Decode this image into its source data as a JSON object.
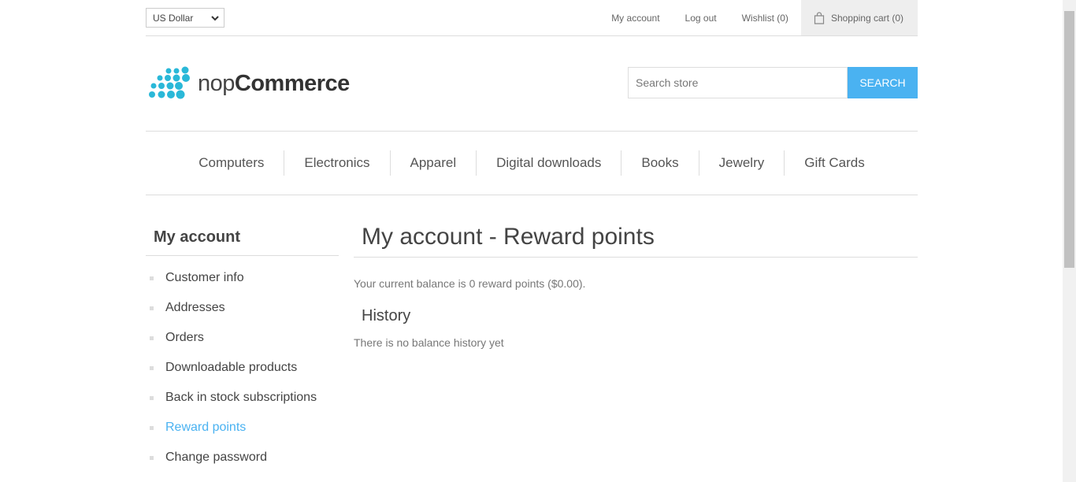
{
  "header": {
    "currency": "US Dollar",
    "links": {
      "my_account": "My account",
      "log_out": "Log out",
      "wishlist": "Wishlist (0)",
      "shopping_cart": "Shopping cart (0)"
    },
    "logo": {
      "part1": "nop",
      "part2": "Commerce"
    },
    "search": {
      "placeholder": "Search store",
      "button": "SEARCH"
    }
  },
  "menu": [
    "Computers",
    "Electronics",
    "Apparel",
    "Digital downloads",
    "Books",
    "Jewelry",
    "Gift Cards"
  ],
  "sidebar": {
    "title": "My account",
    "items": [
      {
        "label": "Customer info"
      },
      {
        "label": "Addresses"
      },
      {
        "label": "Orders"
      },
      {
        "label": "Downloadable products"
      },
      {
        "label": "Back in stock subscriptions"
      },
      {
        "label": "Reward points",
        "active": true
      },
      {
        "label": "Change password"
      }
    ]
  },
  "main": {
    "title": "My account - Reward points",
    "balance": "Your current balance is 0 reward points ($0.00).",
    "history_title": "History",
    "no_history": "There is no balance history yet"
  },
  "colors": {
    "accent": "#4ab2f1",
    "logo_dots": "#2ab8d8"
  },
  "icons": {
    "cart": "shopping-bag-icon",
    "select": "chevron-down-icon"
  }
}
